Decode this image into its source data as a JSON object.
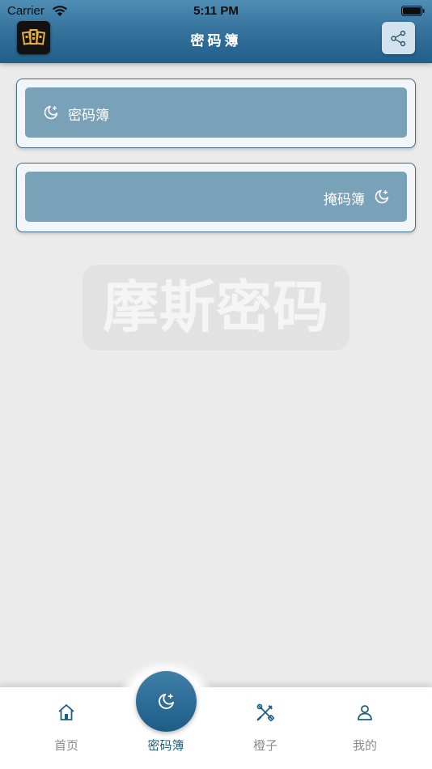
{
  "status_bar": {
    "carrier": "Carrier",
    "time": "5:11 PM"
  },
  "header": {
    "title": "密码簿",
    "logo_icon": "bank-building-icon",
    "share_icon": "share-icon"
  },
  "cards": [
    {
      "label": "密码簿",
      "icon": "moon-star-icon",
      "align": "left"
    },
    {
      "label": "掩码簿",
      "icon": "moon-star-icon",
      "align": "right"
    }
  ],
  "watermark": {
    "text": "摩斯密码"
  },
  "tabbar": {
    "items": [
      {
        "label": "首页",
        "icon": "home-icon"
      },
      {
        "label": "密码簿",
        "icon": "moon-star-icon",
        "active": true
      },
      {
        "label": "橙子",
        "icon": "tools-icon"
      },
      {
        "label": "我的",
        "icon": "user-icon"
      }
    ]
  },
  "colors": {
    "header_top": "#4e8db4",
    "header_bottom": "#1f5f8a",
    "card_fill": "#79a1b8",
    "active_tab": "#1e5e86",
    "background": "#ebebeb"
  }
}
